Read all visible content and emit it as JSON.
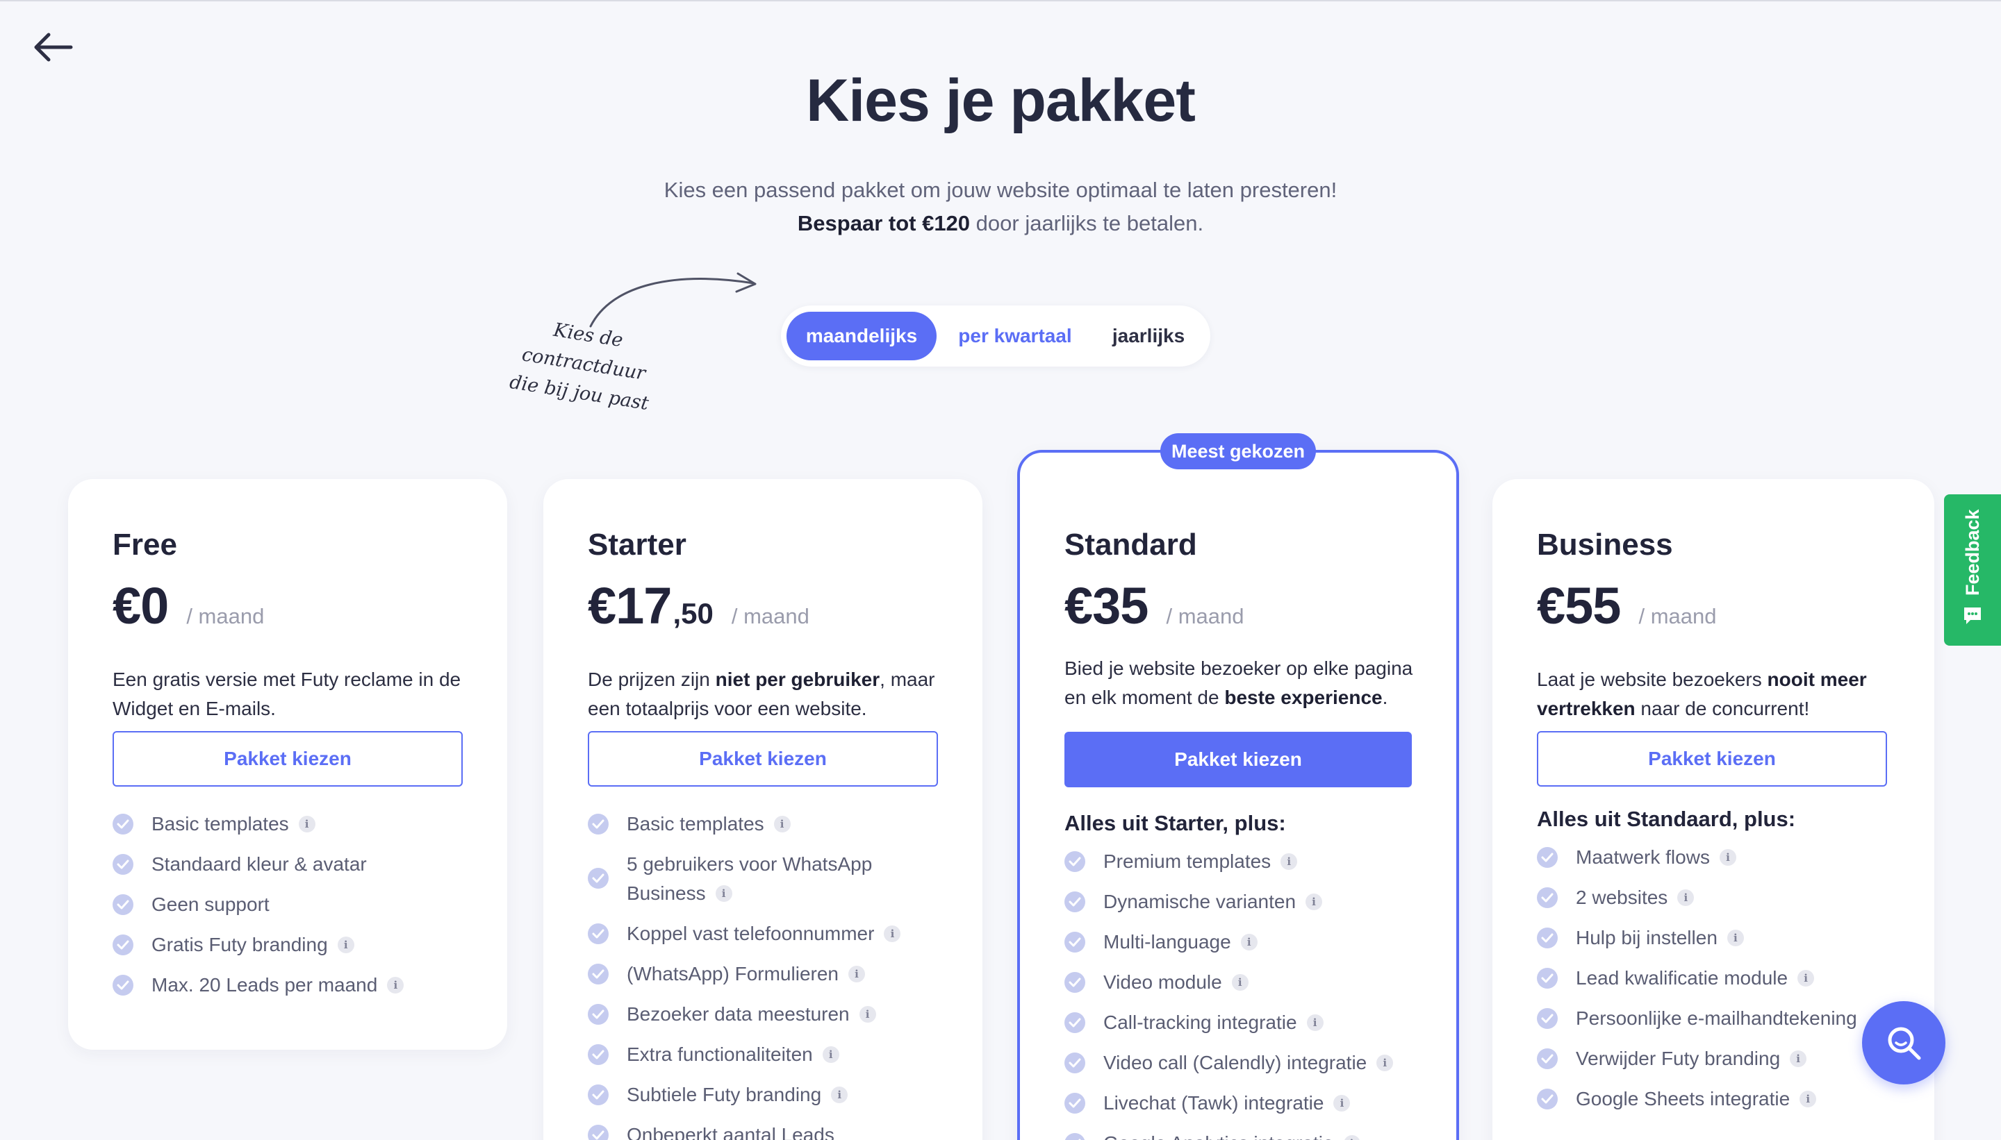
{
  "page": {
    "title": "Kies je pakket",
    "subtitle_line1": "Kies een passend pakket om jouw website optimaal te laten presteren!",
    "subtitle_bold": "Bespaar tot €120",
    "subtitle_rest": " door jaarlijks te betalen.",
    "hand_note_line1": "Kies de contractduur",
    "hand_note_line2": "die bij jou past"
  },
  "billing_toggle": {
    "options": [
      "maandelijks",
      "per kwartaal",
      "jaarlijks"
    ],
    "selected": "maandelijks"
  },
  "plans": [
    {
      "name": "Free",
      "price": "€0",
      "cents": "",
      "period": "/ maand",
      "desc_parts": [
        "Een gratis versie met Futy reclame in de Widget en E-mails."
      ],
      "button": "Pakket kiezen",
      "features": [
        {
          "text": "Basic templates",
          "info": true
        },
        {
          "text": "Standaard kleur & avatar",
          "info": false
        },
        {
          "text": "Geen support",
          "info": false
        },
        {
          "text": "Gratis Futy branding",
          "info": true
        },
        {
          "text": "Max. 20 Leads per maand",
          "info": true
        }
      ]
    },
    {
      "name": "Starter",
      "price": "€17",
      "cents": ",50",
      "period": "/ maand",
      "desc_a": "De prijzen zijn ",
      "desc_b": "niet per gebruiker",
      "desc_c": ", maar een totaalprijs voor een website.",
      "button": "Pakket kiezen",
      "features": [
        {
          "text": "Basic templates",
          "info": true
        },
        {
          "text": "5 gebruikers voor WhatsApp Business",
          "info": true
        },
        {
          "text": "Koppel vast telefoonnummer",
          "info": true
        },
        {
          "text": "(WhatsApp) Formulieren",
          "info": true
        },
        {
          "text": "Bezoeker data meesturen",
          "info": true
        },
        {
          "text": "Extra functionaliteiten",
          "info": true
        },
        {
          "text": "Subtiele Futy branding",
          "info": true
        },
        {
          "text": "Onbeperkt aantal Leads",
          "info": false
        }
      ]
    },
    {
      "name": "Standard",
      "badge": "Meest gekozen",
      "price": "€35",
      "cents": "",
      "period": "/ maand",
      "desc_a": "Bied je website bezoeker op elke pagina en elk moment de ",
      "desc_b": "beste experience",
      "desc_c": ".",
      "button": "Pakket kiezen",
      "list_head": "Alles uit Starter, plus:",
      "features": [
        {
          "text": "Premium templates",
          "info": true
        },
        {
          "text": "Dynamische varianten",
          "info": true
        },
        {
          "text": "Multi-language",
          "info": true
        },
        {
          "text": "Video module",
          "info": true
        },
        {
          "text": "Call-tracking integratie",
          "info": true
        },
        {
          "text": "Video call (Calendly) integratie",
          "info": true
        },
        {
          "text": "Livechat (Tawk) integratie",
          "info": true
        },
        {
          "text": "Google Analytics integratie",
          "info": true
        }
      ]
    },
    {
      "name": "Business",
      "price": "€55",
      "cents": "",
      "period": "/ maand",
      "desc_a": "Laat je website bezoekers ",
      "desc_b": "nooit meer vertrekken",
      "desc_c": " naar de concurrent!",
      "button": "Pakket kiezen",
      "list_head": "Alles uit Standaard, plus:",
      "features": [
        {
          "text": "Maatwerk flows",
          "info": true
        },
        {
          "text": "2 websites",
          "info": true
        },
        {
          "text": "Hulp bij instellen",
          "info": true
        },
        {
          "text": "Lead kwalificatie module",
          "info": true
        },
        {
          "text": "Persoonlijke e-mailhandtekening",
          "info": false
        },
        {
          "text": "Verwijder Futy branding",
          "info": true
        },
        {
          "text": "Google Sheets integratie",
          "info": true
        }
      ]
    }
  ],
  "widgets": {
    "feedback_label": "Feedback",
    "icons": [
      "arrow-left-icon",
      "check-icon",
      "info-icon",
      "search-icon",
      "chat-icon"
    ],
    "accent": "#5b6ef5",
    "feedback_color": "#26b867"
  }
}
